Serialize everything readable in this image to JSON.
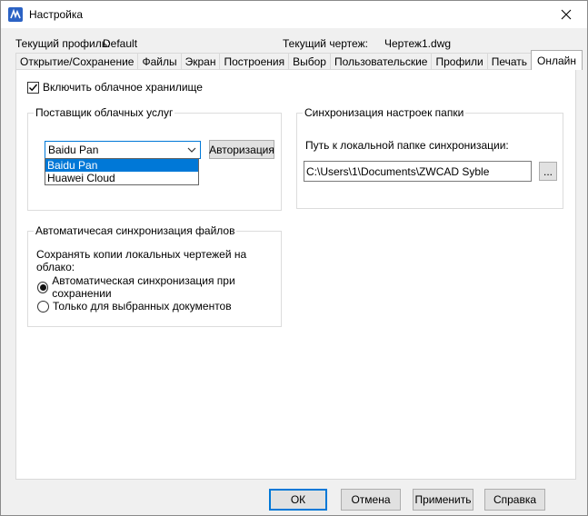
{
  "window": {
    "title": "Настройка",
    "close_glyph": "✕",
    "icon": "zwcad-app-icon"
  },
  "info": {
    "profile_label": "Текущий профиль:",
    "profile_value": "Default",
    "drawing_label": "Текущий чертеж:",
    "drawing_value": "Чертеж1.dwg"
  },
  "tabs": [
    {
      "label": "Открытие/Сохранение"
    },
    {
      "label": "Файлы"
    },
    {
      "label": "Экран"
    },
    {
      "label": "Построения"
    },
    {
      "label": "Выбор"
    },
    {
      "label": "Пользовательские"
    },
    {
      "label": "Профили"
    },
    {
      "label": "Печать"
    },
    {
      "label": "Онлайн",
      "active": true
    }
  ],
  "online": {
    "enable_cloud_label": "Включить облачное хранилище",
    "enable_cloud_checked": true,
    "provider_group": {
      "title": "Поставщик облачных услуг",
      "combo_value": "Baidu Pan",
      "options": [
        "Baidu Pan",
        "Huawei Cloud"
      ],
      "selected_index": 0,
      "auth_button": "Авторизация"
    },
    "sync_settings_group": {
      "title": "Синхронизация настроек папки",
      "path_label": "Путь к локальной папке синхронизации:",
      "path_value": "C:\\Users\\1\\Documents\\ZWCAD Syble",
      "browse_button": "..."
    },
    "auto_sync_group": {
      "title": "Автоматичесая синхронизация файлов",
      "subtitle": "Сохранять копии локальных чертежей на облако:",
      "options": [
        {
          "label": "Автоматическая синхронизация при сохранении",
          "selected": true
        },
        {
          "label": "Только для выбранных документов",
          "selected": false
        }
      ]
    }
  },
  "footer": {
    "ok": "ОК",
    "cancel": "Отмена",
    "apply": "Применить",
    "help": "Справка"
  },
  "colors": {
    "accent": "#0078d7",
    "dialog_bg": "#f0f0f0",
    "panel_bg": "#ffffff",
    "button_bg": "#e1e1e1"
  }
}
